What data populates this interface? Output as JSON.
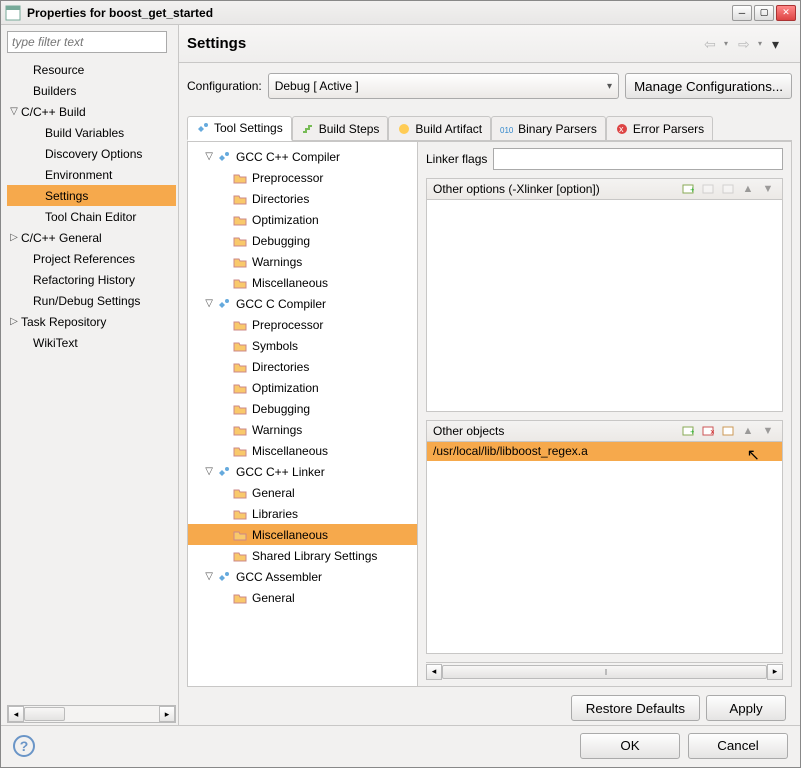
{
  "window": {
    "title": "Properties for boost_get_started"
  },
  "filter_placeholder": "type filter text",
  "left_tree": [
    {
      "label": "Resource",
      "indent": 1,
      "arrow": ""
    },
    {
      "label": "Builders",
      "indent": 1,
      "arrow": ""
    },
    {
      "label": "C/C++ Build",
      "indent": 0,
      "arrow": "▽"
    },
    {
      "label": "Build Variables",
      "indent": 2,
      "arrow": ""
    },
    {
      "label": "Discovery Options",
      "indent": 2,
      "arrow": ""
    },
    {
      "label": "Environment",
      "indent": 2,
      "arrow": ""
    },
    {
      "label": "Settings",
      "indent": 2,
      "arrow": "",
      "selected": true
    },
    {
      "label": "Tool Chain Editor",
      "indent": 2,
      "arrow": ""
    },
    {
      "label": "C/C++ General",
      "indent": 0,
      "arrow": "▷"
    },
    {
      "label": "Project References",
      "indent": 1,
      "arrow": ""
    },
    {
      "label": "Refactoring History",
      "indent": 1,
      "arrow": ""
    },
    {
      "label": "Run/Debug Settings",
      "indent": 1,
      "arrow": ""
    },
    {
      "label": "Task Repository",
      "indent": 0,
      "arrow": "▷"
    },
    {
      "label": "WikiText",
      "indent": 1,
      "arrow": ""
    }
  ],
  "page_title": "Settings",
  "config_label": "Configuration:",
  "config_value": "Debug  [ Active ]",
  "manage_label": "Manage Configurations...",
  "tabs": [
    {
      "label": "Tool Settings",
      "active": true,
      "icon": "tool"
    },
    {
      "label": "Build Steps",
      "active": false,
      "icon": "steps"
    },
    {
      "label": "Build Artifact",
      "active": false,
      "icon": "artifact"
    },
    {
      "label": "Binary Parsers",
      "active": false,
      "icon": "binary"
    },
    {
      "label": "Error Parsers",
      "active": false,
      "icon": "error"
    }
  ],
  "tool_tree": [
    {
      "label": "GCC C++ Compiler",
      "arrow": "▽",
      "icon": "tool"
    },
    {
      "label": "Preprocessor",
      "leaf": true,
      "icon": "folder"
    },
    {
      "label": "Directories",
      "leaf": true,
      "icon": "folder"
    },
    {
      "label": "Optimization",
      "leaf": true,
      "icon": "folder"
    },
    {
      "label": "Debugging",
      "leaf": true,
      "icon": "folder"
    },
    {
      "label": "Warnings",
      "leaf": true,
      "icon": "folder"
    },
    {
      "label": "Miscellaneous",
      "leaf": true,
      "icon": "folder"
    },
    {
      "label": "GCC C Compiler",
      "arrow": "▽",
      "icon": "tool"
    },
    {
      "label": "Preprocessor",
      "leaf": true,
      "icon": "folder"
    },
    {
      "label": "Symbols",
      "leaf": true,
      "icon": "folder"
    },
    {
      "label": "Directories",
      "leaf": true,
      "icon": "folder"
    },
    {
      "label": "Optimization",
      "leaf": true,
      "icon": "folder"
    },
    {
      "label": "Debugging",
      "leaf": true,
      "icon": "folder"
    },
    {
      "label": "Warnings",
      "leaf": true,
      "icon": "folder"
    },
    {
      "label": "Miscellaneous",
      "leaf": true,
      "icon": "folder"
    },
    {
      "label": "GCC C++ Linker",
      "arrow": "▽",
      "icon": "tool"
    },
    {
      "label": "General",
      "leaf": true,
      "icon": "folder"
    },
    {
      "label": "Libraries",
      "leaf": true,
      "icon": "folder"
    },
    {
      "label": "Miscellaneous",
      "leaf": true,
      "icon": "folder",
      "selected": true
    },
    {
      "label": "Shared Library Settings",
      "leaf": true,
      "icon": "folder"
    },
    {
      "label": "GCC Assembler",
      "arrow": "▽",
      "icon": "tool"
    },
    {
      "label": "General",
      "leaf": true,
      "icon": "folder"
    }
  ],
  "details": {
    "linker_flags_label": "Linker flags",
    "other_options_label": "Other options (-Xlinker [option])",
    "other_objects_label": "Other objects",
    "other_objects_items": [
      "/usr/local/lib/libboost_regex.a"
    ]
  },
  "buttons": {
    "restore": "Restore Defaults",
    "apply": "Apply",
    "ok": "OK",
    "cancel": "Cancel"
  }
}
